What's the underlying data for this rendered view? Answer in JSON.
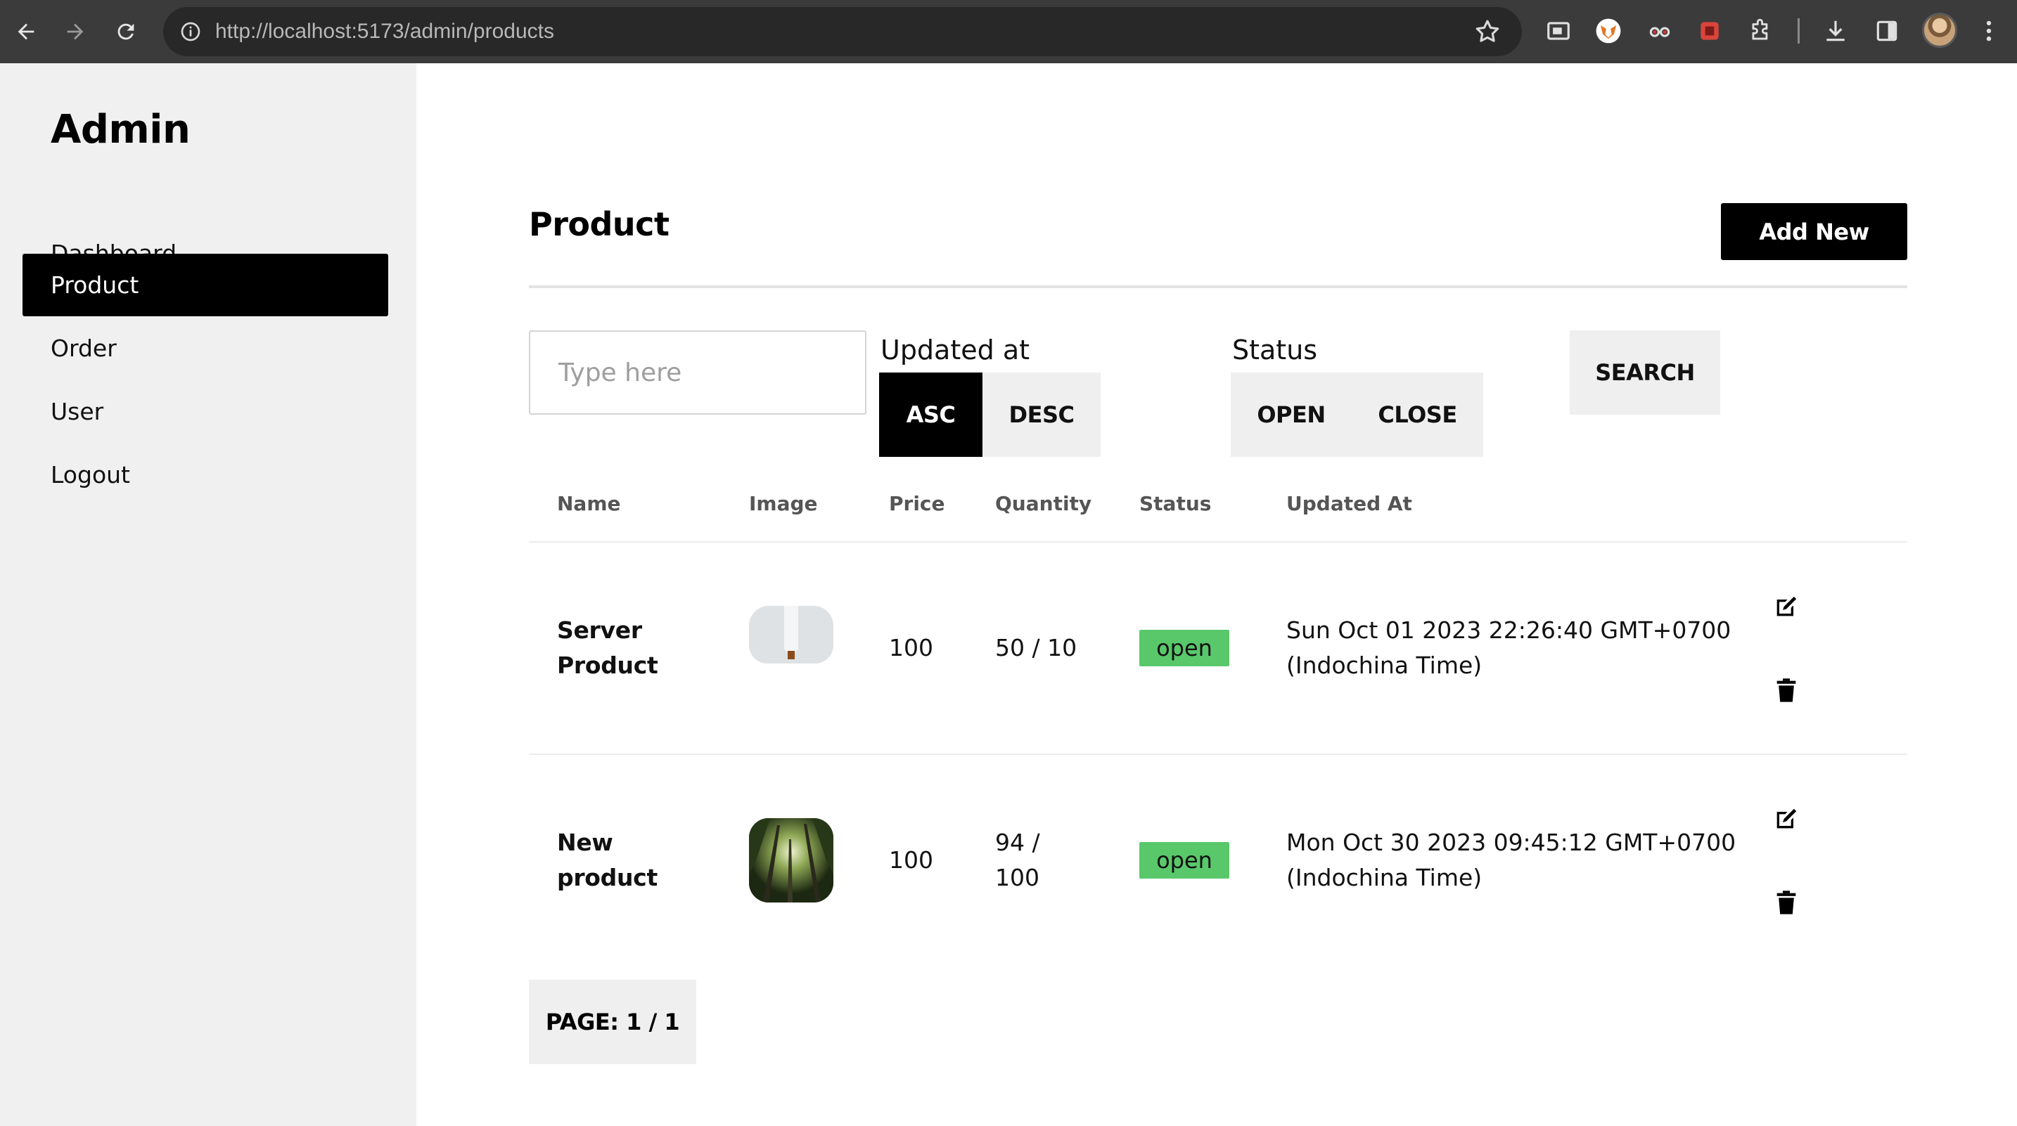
{
  "browser": {
    "url": "http://localhost:5173/admin/products"
  },
  "sidebar": {
    "brand": "Admin",
    "items": [
      {
        "label": "Dashboard",
        "active": false
      },
      {
        "label": "Product",
        "active": true
      },
      {
        "label": "Order",
        "active": false
      },
      {
        "label": "User",
        "active": false
      },
      {
        "label": "Logout",
        "active": false
      }
    ]
  },
  "main": {
    "title": "Product",
    "add_button": "Add New",
    "search": {
      "placeholder": "Type here",
      "value": "",
      "button": "SEARCH"
    },
    "sort": {
      "label": "Updated at",
      "options": [
        "ASC",
        "DESC"
      ],
      "selected": "ASC"
    },
    "status_filter": {
      "label": "Status",
      "options": [
        "OPEN",
        "CLOSE"
      ]
    },
    "table": {
      "columns": [
        "Name",
        "Image",
        "Price",
        "Quantity",
        "Status",
        "Updated At"
      ],
      "rows": [
        {
          "name_line1": "Server",
          "name_line2": "Product",
          "image": "white-product-photo",
          "price": "100",
          "quantity_line1": "50 / 10",
          "quantity_line2": "",
          "status": "open",
          "updated_line1": "Sun Oct 01 2023 22:26:40 GMT+0700",
          "updated_line2": "(Indochina Time)"
        },
        {
          "name_line1": "New",
          "name_line2": "product",
          "image": "forest-photo",
          "price": "100",
          "quantity_line1": "94 /",
          "quantity_line2": "100",
          "status": "open",
          "updated_line1": "Mon Oct 30 2023 09:45:12 GMT+0700",
          "updated_line2": "(Indochina Time)"
        }
      ]
    },
    "pagination": "PAGE: 1 / 1"
  },
  "colors": {
    "accent": "#000000",
    "sidebar_bg": "#f0f0f0",
    "status_open": "#59c86b",
    "chrome_bg": "#3b3b3b"
  },
  "icons": {
    "edit": "edit-icon",
    "delete": "trash-icon"
  }
}
